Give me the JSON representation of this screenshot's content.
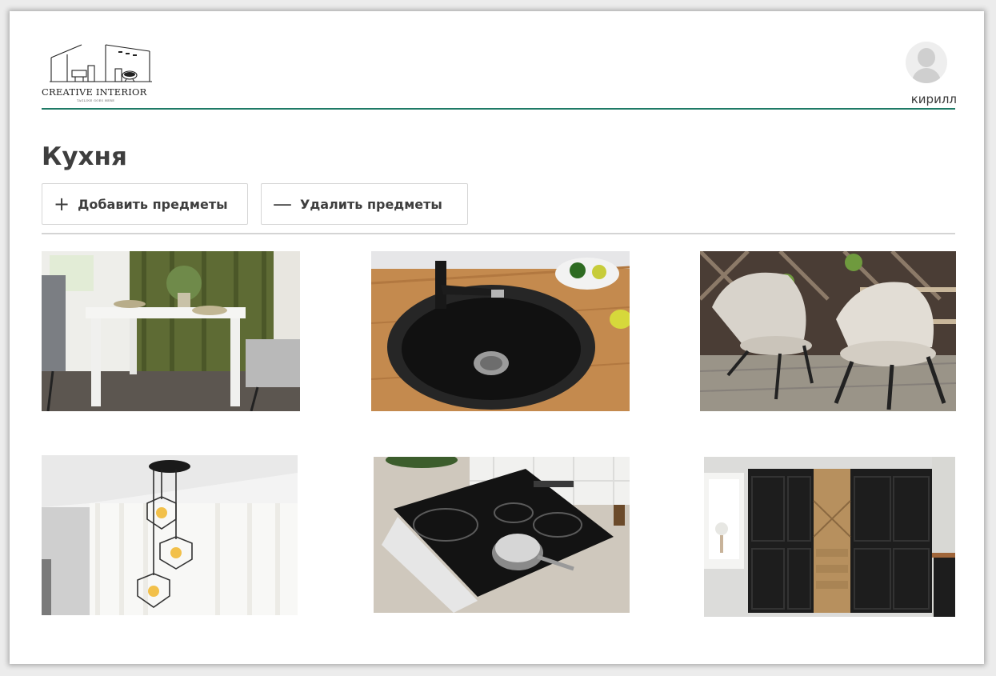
{
  "brand": {
    "name": "CREATIVE INTERIOR",
    "tagline": "TAGLINE GOES HERE"
  },
  "user": {
    "name": "кирилл",
    "avatar_icon": "user-avatar-icon"
  },
  "page": {
    "title": "Кухня"
  },
  "toolbar": {
    "add_icon": "+",
    "add_label": "Добавить предметы",
    "remove_icon": "—",
    "remove_label": "Удалить предметы"
  },
  "items": [
    {
      "image": "dining-table-with-chairs"
    },
    {
      "image": "round-black-sink"
    },
    {
      "image": "upholstered-chairs"
    },
    {
      "image": "pendant-lamp"
    },
    {
      "image": "induction-cooktop"
    },
    {
      "image": "black-kitchen-cabinet"
    }
  ],
  "colors": {
    "accent": "#1f7a66",
    "heading": "#3e3e3e"
  }
}
